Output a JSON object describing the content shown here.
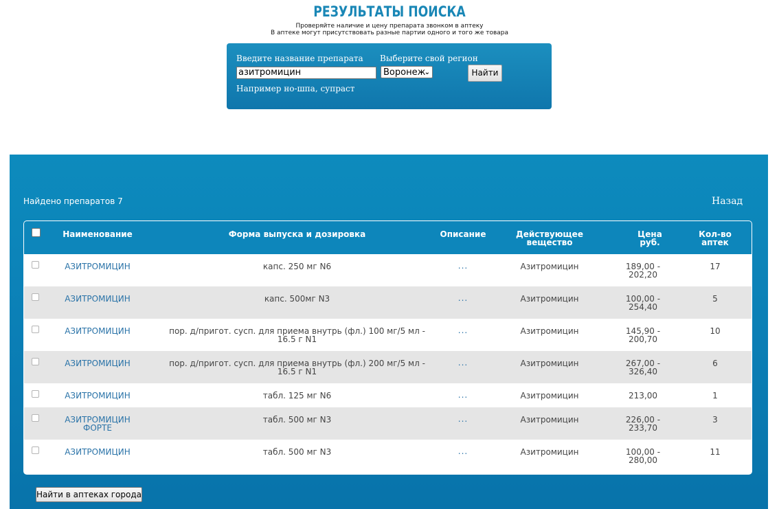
{
  "header": {
    "title": "РЕЗУЛЬТАТЫ ПОИСКА",
    "subtitle_1": "Проверяйте наличие и цену препарата звонком в аптеку",
    "subtitle_2": "В аптеке могут присутствовать разные партии одного и того же товара"
  },
  "search": {
    "name_label": "Введите название препарата",
    "name_value": "азитромицин",
    "region_label": "Выберите свой регион",
    "region_value": "Воронеж",
    "hint": "Например но-шпа, супраст",
    "submit_label": "Найти"
  },
  "results": {
    "found_label": "Найдено препаратов 7",
    "back_label": "Назад",
    "columns": {
      "name": "Наименование",
      "form": "Форма выпуска и дозировка",
      "description": "Описание",
      "substance_1": "Действующее",
      "substance_2": "вещество",
      "price_1": "Цена",
      "price_2": "руб.",
      "count_1": "Кол-во",
      "count_2": "аптек"
    },
    "rows": [
      {
        "name_1": "АЗИТРОМИЦИН",
        "name_2": "",
        "form_1": "капс. 250 мг N6",
        "form_2": "",
        "desc": "...",
        "substance": "Азитромицин",
        "price_1": "189,00 -",
        "price_2": "202,20",
        "count": "17"
      },
      {
        "name_1": "АЗИТРОМИЦИН",
        "name_2": "",
        "form_1": "капс. 500мг N3",
        "form_2": "",
        "desc": "...",
        "substance": "Азитромицин",
        "price_1": "100,00 -",
        "price_2": "254,40",
        "count": "5"
      },
      {
        "name_1": "АЗИТРОМИЦИН",
        "name_2": "",
        "form_1": "пор. д/пригот. сусп. для приема внутрь (фл.) 100 мг/5 мл -",
        "form_2": "16.5 г N1",
        "desc": "...",
        "substance": "Азитромицин",
        "price_1": "145,90 -",
        "price_2": "200,70",
        "count": "10"
      },
      {
        "name_1": "АЗИТРОМИЦИН",
        "name_2": "",
        "form_1": "пор. д/пригот. сусп. для приема внутрь (фл.) 200 мг/5 мл -",
        "form_2": "16.5 г N1",
        "desc": "...",
        "substance": "Азитромицин",
        "price_1": "267,00 -",
        "price_2": "326,40",
        "count": "6"
      },
      {
        "name_1": "АЗИТРОМИЦИН",
        "name_2": "",
        "form_1": "табл. 125 мг N6",
        "form_2": "",
        "desc": "...",
        "substance": "Азитромицин",
        "price_1": "213,00",
        "price_2": "",
        "count": "1"
      },
      {
        "name_1": "АЗИТРОМИЦИН",
        "name_2": "ФОРТЕ",
        "form_1": "табл. 500 мг N3",
        "form_2": "",
        "desc": "...",
        "substance": "Азитромицин",
        "price_1": "226,00 -",
        "price_2": "233,70",
        "count": "3"
      },
      {
        "name_1": "АЗИТРОМИЦИН",
        "name_2": "",
        "form_1": "табл. 500 мг N3",
        "form_2": "",
        "desc": "...",
        "substance": "Азитромицин",
        "price_1": "100,00 -",
        "price_2": "280,00",
        "count": "11"
      }
    ],
    "city_button_label": "Найти в аптеках города"
  },
  "colors": {
    "title": "#1a87b6",
    "panel": "#0f76ac",
    "link": "#2a73a8",
    "row_alt": "#e5e5e5"
  }
}
